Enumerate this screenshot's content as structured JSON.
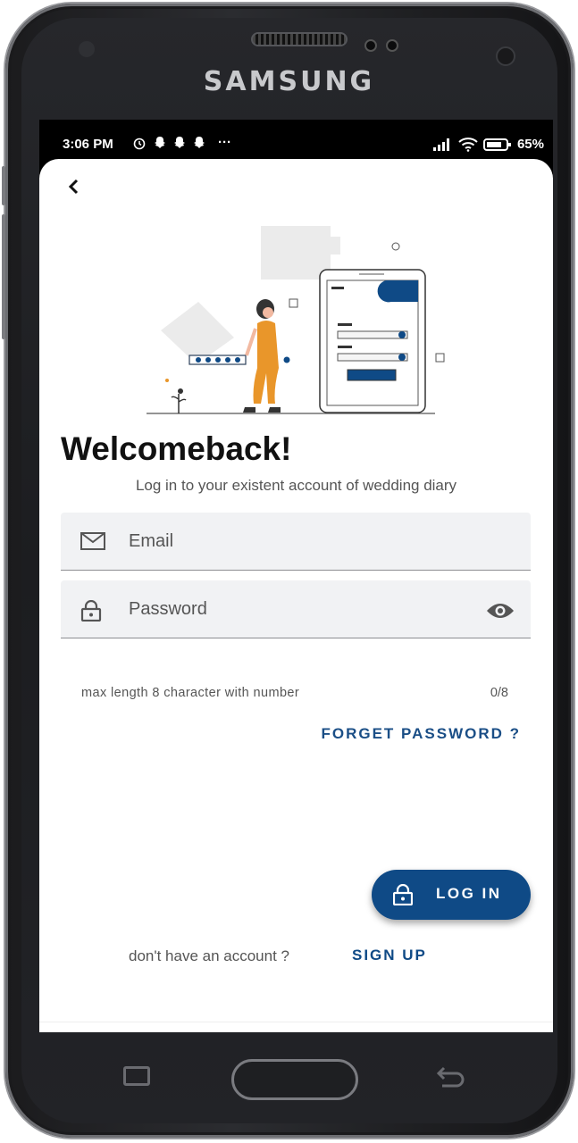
{
  "device": {
    "brand": "SAMSUNG"
  },
  "status_bar": {
    "time": "3:06 PM",
    "battery": "65%",
    "overflow": "···"
  },
  "header": {
    "back_icon": "chevron-left-icon"
  },
  "welcome": {
    "title": "Welcomeback!",
    "subtitle": "Log in to your existent account of wedding diary"
  },
  "form": {
    "email_placeholder": "Email",
    "password_placeholder": "Password",
    "password_helper": "max length 8 character with number",
    "password_counter": "0/8",
    "forget_password": "FORGET PASSWORD ?"
  },
  "actions": {
    "login_label": "LOG IN",
    "no_account_text": "don't have an account ?",
    "signup_label": "SIGN UP"
  },
  "colors": {
    "primary": "#0f4a86",
    "field_bg": "#f1f2f4",
    "illustration_accent": "#e9962a"
  }
}
